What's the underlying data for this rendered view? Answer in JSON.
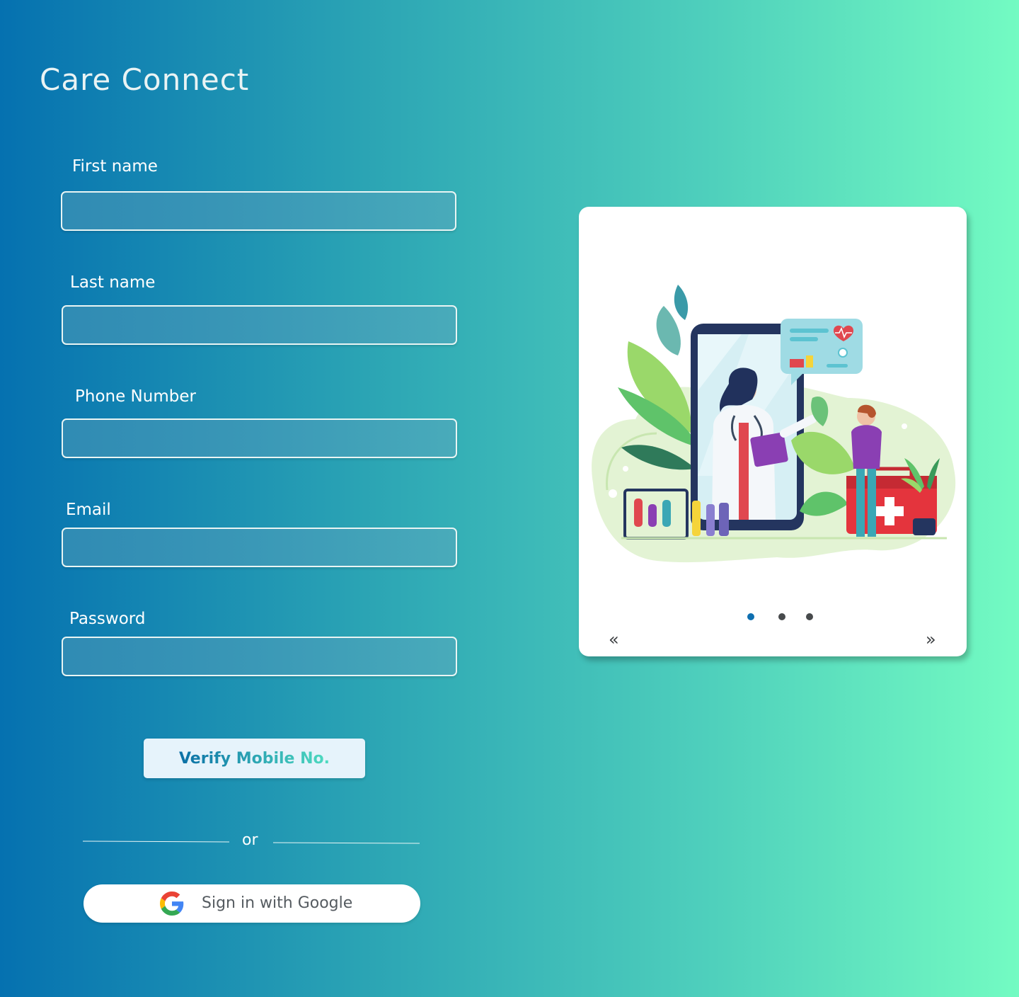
{
  "app": {
    "title": "Care Connect"
  },
  "form": {
    "first_name_label": "First name",
    "first_name_value": "",
    "last_name_label": "Last name",
    "last_name_value": "",
    "phone_label": "Phone Number",
    "phone_value": "",
    "email_label": "Email",
    "email_value": "",
    "password_label": "Password",
    "password_value": "",
    "verify_button_label": "Verify Mobile No.",
    "divider_text": "or",
    "google_button_label": "Sign in with Google"
  },
  "carousel": {
    "prev_label": "«",
    "next_label": "»",
    "dots": 3,
    "active_index": 0,
    "illustration_icon": "doctor-telemedicine-illustration"
  },
  "colors": {
    "gradient_start": "#0571b0",
    "gradient_end": "#73fbc2",
    "active_dot": "#0e6fb0",
    "inactive_dot": "#474a4c"
  }
}
